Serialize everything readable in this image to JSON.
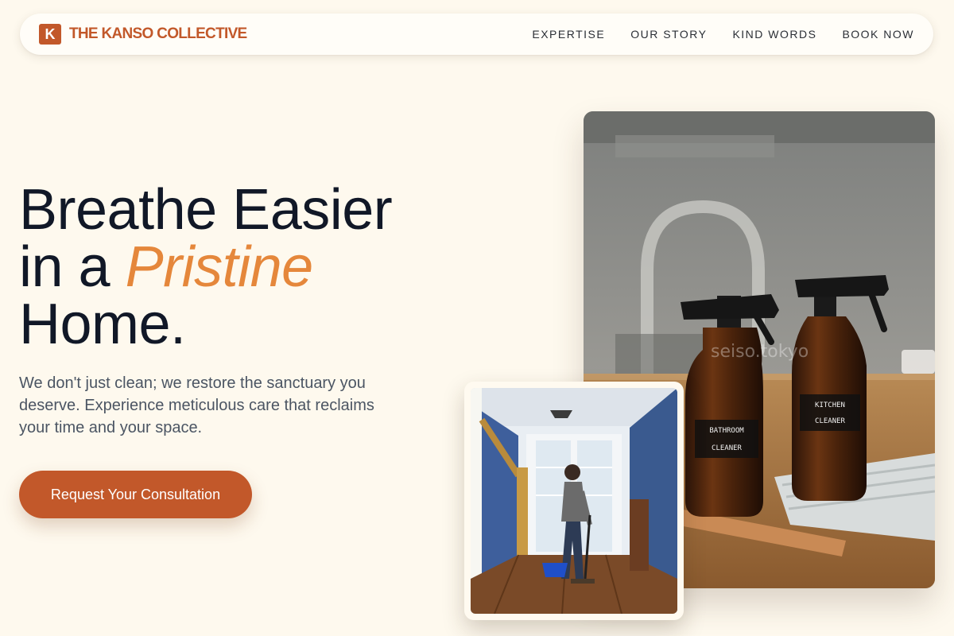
{
  "brand": {
    "mark": "K",
    "name": "THE KANSO COLLECTIVE"
  },
  "nav": {
    "links": [
      {
        "label": "EXPERTISE"
      },
      {
        "label": "OUR STORY"
      },
      {
        "label": "KIND WORDS"
      },
      {
        "label": "BOOK NOW"
      }
    ]
  },
  "hero": {
    "headline_line1": "Breathe Easier",
    "headline_line2_prefix": "in a ",
    "headline_accent": "Pristine",
    "headline_line3": "Home.",
    "subtext": "We don't just clean; we restore the sanctuary you deserve. Experience meticulous care that reclaims your time and your space.",
    "cta_label": "Request Your Consultation"
  },
  "images": {
    "main_watermark": "seiso.tokyo",
    "bottle1_label_line1": "BATHROOM",
    "bottle1_label_line2": "CLEANER",
    "bottle2_label_line1": "KITCHEN",
    "bottle2_label_line2": "CLEANER"
  },
  "colors": {
    "background": "#fef9ee",
    "brand": "#c2582a",
    "accent": "#e5873b",
    "heading": "#111827",
    "body_text": "#4b5563"
  }
}
